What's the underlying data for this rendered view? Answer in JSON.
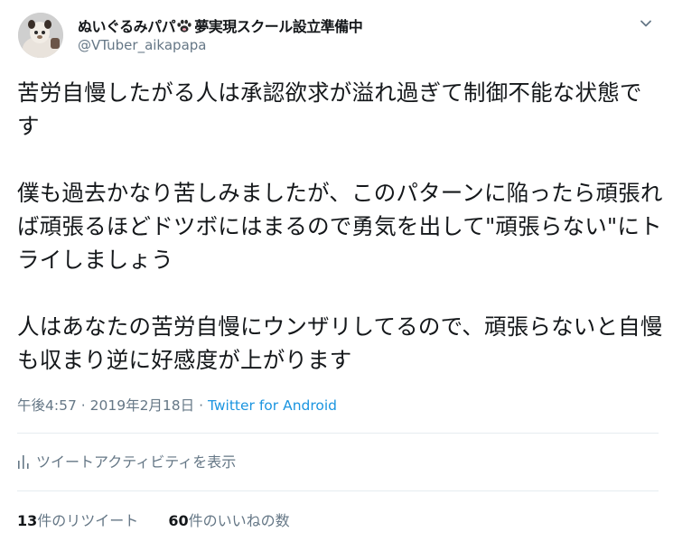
{
  "user": {
    "display_name_prefix": "ぬいぐるみパパ",
    "display_name_suffix": "夢実現スクール設立準備中",
    "handle": "@VTuber_aikapapa",
    "paw_icon": "paw-emoji"
  },
  "tweet": {
    "paragraphs": [
      "苦労自慢したがる人は承認欲求が溢れ過ぎて制御不能な状態です",
      "僕も過去かなり苦しみましたが、このパターンに陥ったら頑張れば頑張るほどドツボにはまるので勇気を出して\"頑張らない\"にトライしましょう",
      "人はあなたの苦労自慢にウンザリしてるので、頑張らないと自慢も収まり逆に好感度が上がります"
    ],
    "time": "午後4:57",
    "separator": "·",
    "date": "2019年2月18日",
    "source": "Twitter for Android"
  },
  "activity": {
    "label": "ツイートアクティビティを表示",
    "icon": "bar-chart-icon"
  },
  "stats": {
    "retweet_count": "13",
    "retweet_label": "件のリツイート",
    "like_count": "60",
    "like_label": "件のいいねの数"
  },
  "colors": {
    "text": "#14171a",
    "secondary": "#657786",
    "link": "#1b95e0",
    "divider": "#e6ecf0"
  }
}
